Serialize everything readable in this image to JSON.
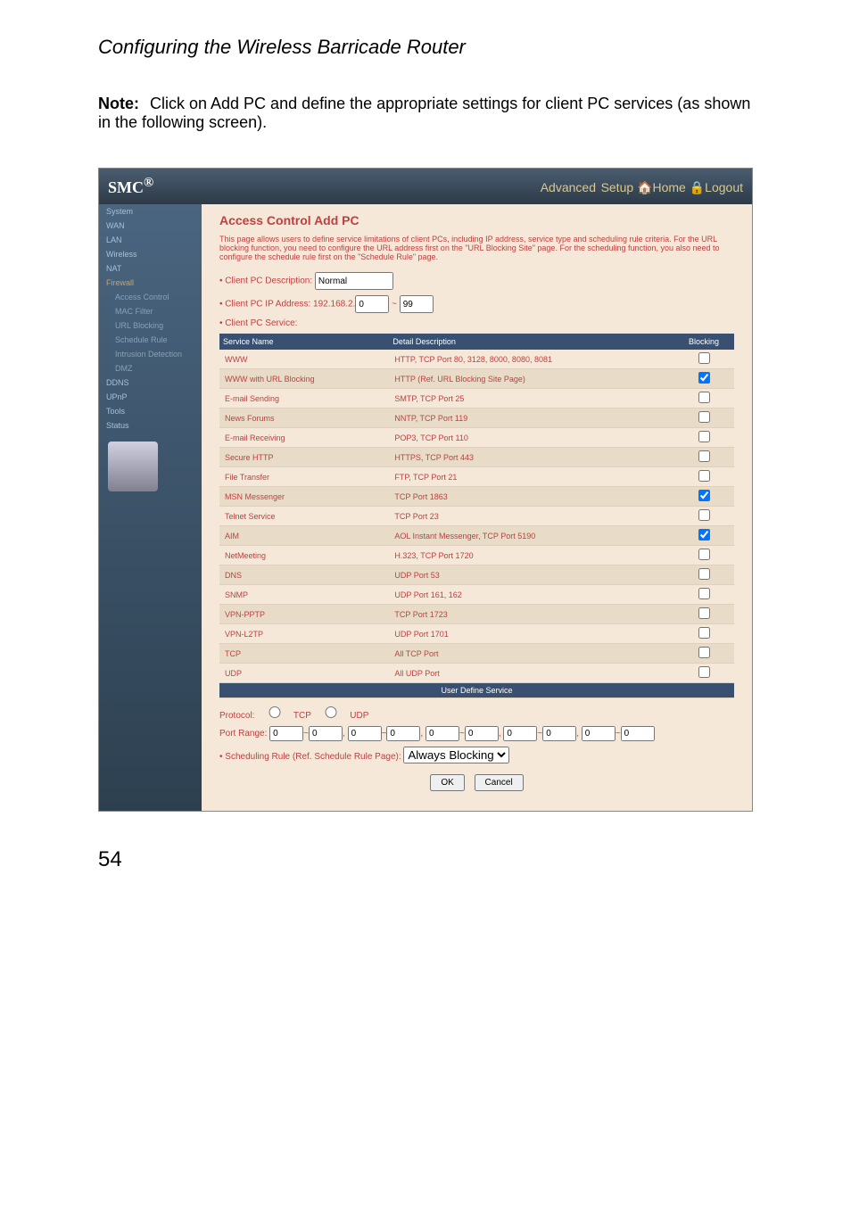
{
  "page": {
    "title": "Configuring the Wireless Barricade Router",
    "noteLabel": "Note:",
    "noteText": "Click on Add PC and define the appropriate settings for client PC services (as shown in the following screen).",
    "pgnum": "54"
  },
  "header": {
    "logo": "SMC",
    "adv": "Advanced",
    "setup": "Setup",
    "home": "Home",
    "logout": "Logout"
  },
  "nav": {
    "items": [
      "System",
      "WAN",
      "LAN",
      "Wireless",
      "NAT",
      "Firewall"
    ],
    "subs": [
      "Access Control",
      "MAC Filter",
      "URL Blocking",
      "Schedule Rule",
      "Intrusion Detection",
      "DMZ"
    ],
    "items2": [
      "DDNS",
      "UPnP",
      "Tools",
      "Status"
    ]
  },
  "content": {
    "heading": "Access Control Add PC",
    "desc": "This page allows users to define service limitations of client PCs, including IP address, service type and scheduling rule criteria. For the URL blocking function, you need to configure the URL address first on the \"URL Blocking Site\" page. For the scheduling function, you also need to configure the schedule rule first on the \"Schedule Rule\" page.",
    "descLabel": "Client PC Description:",
    "descVal": "Normal",
    "ipLabel": "Client PC IP Address:",
    "ipPrefix": "192.168.2.",
    "ipFrom": "0",
    "ipTo": "99",
    "svcLabel": "Client PC Service:"
  },
  "cols": {
    "name": "Service Name",
    "detail": "Detail Description",
    "block": "Blocking"
  },
  "rows": [
    {
      "name": "WWW",
      "detail": "HTTP, TCP Port 80, 3128, 8000, 8080, 8081",
      "chk": false
    },
    {
      "name": "WWW with URL Blocking",
      "detail": "HTTP (Ref. URL Blocking Site Page)",
      "chk": true
    },
    {
      "name": "E-mail Sending",
      "detail": "SMTP, TCP Port 25",
      "chk": false
    },
    {
      "name": "News Forums",
      "detail": "NNTP, TCP Port 119",
      "chk": false
    },
    {
      "name": "E-mail Receiving",
      "detail": "POP3, TCP Port 110",
      "chk": false
    },
    {
      "name": "Secure HTTP",
      "detail": "HTTPS, TCP Port 443",
      "chk": false
    },
    {
      "name": "File Transfer",
      "detail": "FTP, TCP Port 21",
      "chk": false
    },
    {
      "name": "MSN Messenger",
      "detail": "TCP Port 1863",
      "chk": true
    },
    {
      "name": "Telnet Service",
      "detail": "TCP Port 23",
      "chk": false
    },
    {
      "name": "AIM",
      "detail": "AOL Instant Messenger, TCP Port 5190",
      "chk": true
    },
    {
      "name": "NetMeeting",
      "detail": "H.323, TCP Port 1720",
      "chk": false
    },
    {
      "name": "DNS",
      "detail": "UDP Port 53",
      "chk": false
    },
    {
      "name": "SNMP",
      "detail": "UDP Port 161, 162",
      "chk": false
    },
    {
      "name": "VPN-PPTP",
      "detail": "TCP Port 1723",
      "chk": false
    },
    {
      "name": "VPN-L2TP",
      "detail": "UDP Port 1701",
      "chk": false
    },
    {
      "name": "TCP",
      "detail": "All TCP Port",
      "chk": false
    },
    {
      "name": "UDP",
      "detail": "All UDP Port",
      "chk": false
    }
  ],
  "uds": {
    "title": "User Define Service",
    "protoLabel": "Protocol:",
    "tcp": "TCP",
    "udp": "UDP",
    "rangeLabel": "Port Range:",
    "zeros": [
      "0",
      "0",
      "0",
      "0",
      "0",
      "0",
      "0",
      "0",
      "0",
      "0"
    ],
    "schedLabel": "Scheduling Rule (Ref. Schedule Rule Page):",
    "schedVal": "Always Blocking"
  },
  "btns": {
    "ok": "OK",
    "cancel": "Cancel"
  }
}
